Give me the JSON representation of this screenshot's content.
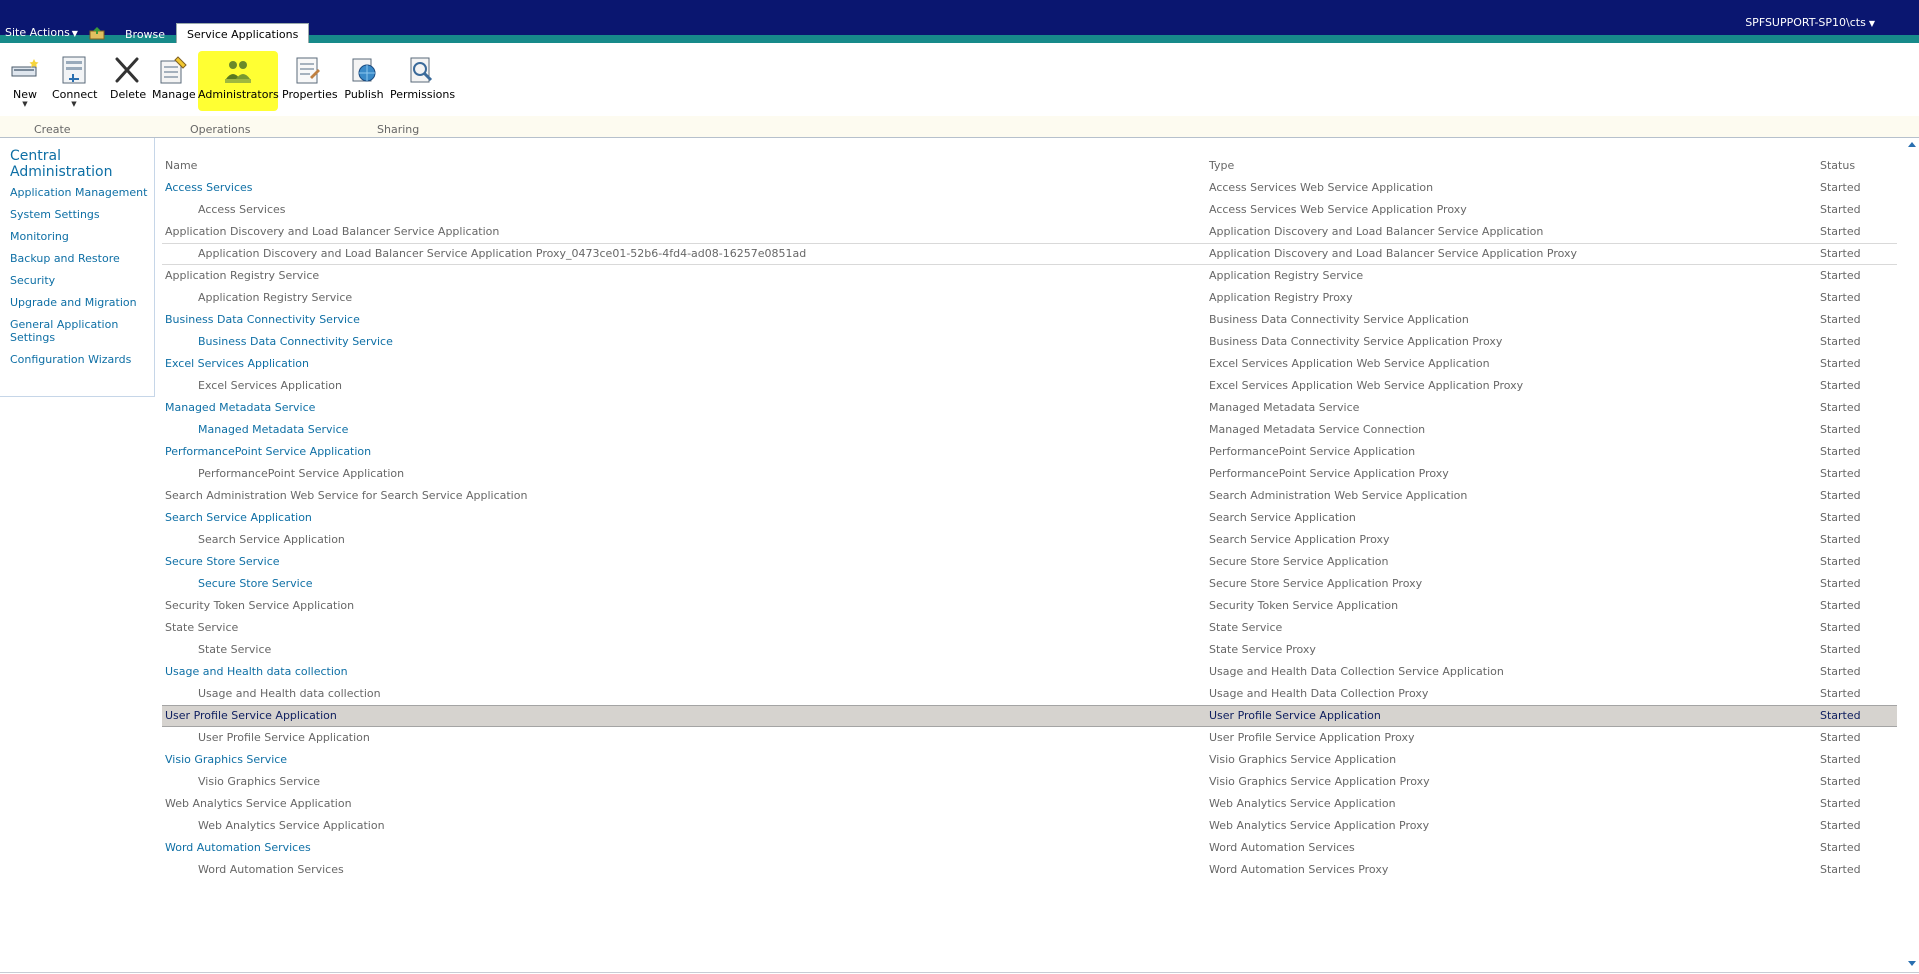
{
  "topbar": {
    "site_actions": "Site Actions",
    "tab_browse": "Browse",
    "tab_active": "Service Applications",
    "user": "SPFSUPPORT-SP10\\cts"
  },
  "ribbon": {
    "buttons": {
      "new": "New",
      "connect": "Connect",
      "delete": "Delete",
      "manage": "Manage",
      "administrators": "Administrators",
      "properties": "Properties",
      "publish": "Publish",
      "permissions": "Permissions"
    },
    "groups": {
      "create": "Create",
      "operations": "Operations",
      "sharing": "Sharing"
    },
    "highlight_color": "#ffff33"
  },
  "leftnav": {
    "heading": "Central Administration",
    "items": [
      "Application Management",
      "System Settings",
      "Monitoring",
      "Backup and Restore",
      "Security",
      "Upgrade and Migration",
      "General Application Settings",
      "Configuration Wizards"
    ]
  },
  "table": {
    "headers": {
      "name": "Name",
      "type": "Type",
      "status": "Status"
    },
    "rows": [
      {
        "name": "Access Services",
        "type": "Access Services Web Service Application",
        "status": "Started"
      },
      {
        "name": "Access Services",
        "type": "Access Services Web Service Application Proxy",
        "status": "Started"
      },
      {
        "name": "Application Discovery and Load Balancer Service Application",
        "type": "Application Discovery and Load Balancer Service Application",
        "status": "Started"
      },
      {
        "name": "Application Discovery and Load Balancer Service Application Proxy_0473ce01-52b6-4fd4-ad08-16257e0851ad",
        "type": "Application Discovery and Load Balancer Service Application Proxy",
        "status": "Started"
      },
      {
        "name": "Application Registry Service",
        "type": "Application Registry Service",
        "status": "Started"
      },
      {
        "name": "Application Registry Service",
        "type": "Application Registry Proxy",
        "status": "Started"
      },
      {
        "name": "Business Data Connectivity Service",
        "type": "Business Data Connectivity Service Application",
        "status": "Started"
      },
      {
        "name": "Business Data Connectivity Service",
        "type": "Business Data Connectivity Service Application Proxy",
        "status": "Started"
      },
      {
        "name": "Excel Services Application",
        "type": "Excel Services Application Web Service Application",
        "status": "Started"
      },
      {
        "name": "Excel Services Application",
        "type": "Excel Services Application Web Service Application Proxy",
        "status": "Started"
      },
      {
        "name": "Managed Metadata Service",
        "type": "Managed Metadata Service",
        "status": "Started"
      },
      {
        "name": "Managed Metadata Service",
        "type": "Managed Metadata Service Connection",
        "status": "Started"
      },
      {
        "name": "PerformancePoint Service Application",
        "type": "PerformancePoint Service Application",
        "status": "Started"
      },
      {
        "name": "PerformancePoint Service Application",
        "type": "PerformancePoint Service Application Proxy",
        "status": "Started"
      },
      {
        "name": "Search Administration Web Service for Search Service Application",
        "type": "Search Administration Web Service Application",
        "status": "Started"
      },
      {
        "name": "Search Service Application",
        "type": "Search Service Application",
        "status": "Started"
      },
      {
        "name": "Search Service Application",
        "type": "Search Service Application Proxy",
        "status": "Started"
      },
      {
        "name": "Secure Store Service",
        "type": "Secure Store Service Application",
        "status": "Started"
      },
      {
        "name": "Secure Store Service",
        "type": "Secure Store Service Application Proxy",
        "status": "Started"
      },
      {
        "name": "Security Token Service Application",
        "type": "Security Token Service Application",
        "status": "Started"
      },
      {
        "name": "State Service",
        "type": "State Service",
        "status": "Started"
      },
      {
        "name": "State Service",
        "type": "State Service Proxy",
        "status": "Started"
      },
      {
        "name": "Usage and Health data collection",
        "type": "Usage and Health Data Collection Service Application",
        "status": "Started"
      },
      {
        "name": "Usage and Health data collection",
        "type": "Usage and Health Data Collection Proxy",
        "status": "Started"
      },
      {
        "name": "User Profile Service Application",
        "type": "User Profile Service Application",
        "status": "Started"
      },
      {
        "name": "User Profile Service Application",
        "type": "User Profile Service Application Proxy",
        "status": "Started"
      },
      {
        "name": "Visio Graphics Service",
        "type": "Visio Graphics Service Application",
        "status": "Started"
      },
      {
        "name": "Visio Graphics Service",
        "type": "Visio Graphics Service Application Proxy",
        "status": "Started"
      },
      {
        "name": "Web Analytics Service Application",
        "type": "Web Analytics Service Application",
        "status": "Started"
      },
      {
        "name": "Web Analytics Service Application",
        "type": "Web Analytics Service Application Proxy",
        "status": "Started"
      },
      {
        "name": "Word Automation Services",
        "type": "Word Automation Services",
        "status": "Started"
      },
      {
        "name": "Word Automation Services",
        "type": "Word Automation Services Proxy",
        "status": "Started"
      }
    ]
  }
}
